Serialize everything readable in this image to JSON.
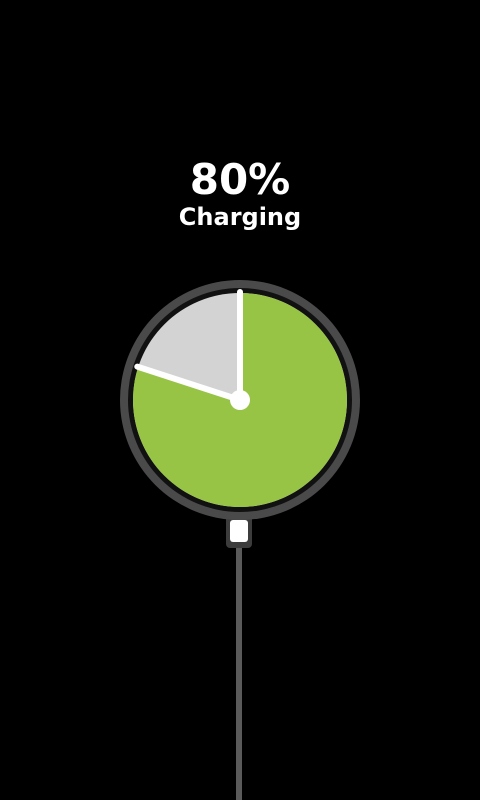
{
  "battery": {
    "percent_label": "80%",
    "status_label": "Charging",
    "level": 0.8
  },
  "colors": {
    "background": "#000000",
    "charged": "#97c445",
    "remaining": "#d3d3d3",
    "bezel": "#4a4a4a",
    "hands": "#ffffff",
    "cable": "#5a5a5a"
  },
  "icons": {
    "gauge": "battery-pie-gauge-icon",
    "plug": "charging-plug-icon",
    "cable": "charging-cable-icon"
  }
}
